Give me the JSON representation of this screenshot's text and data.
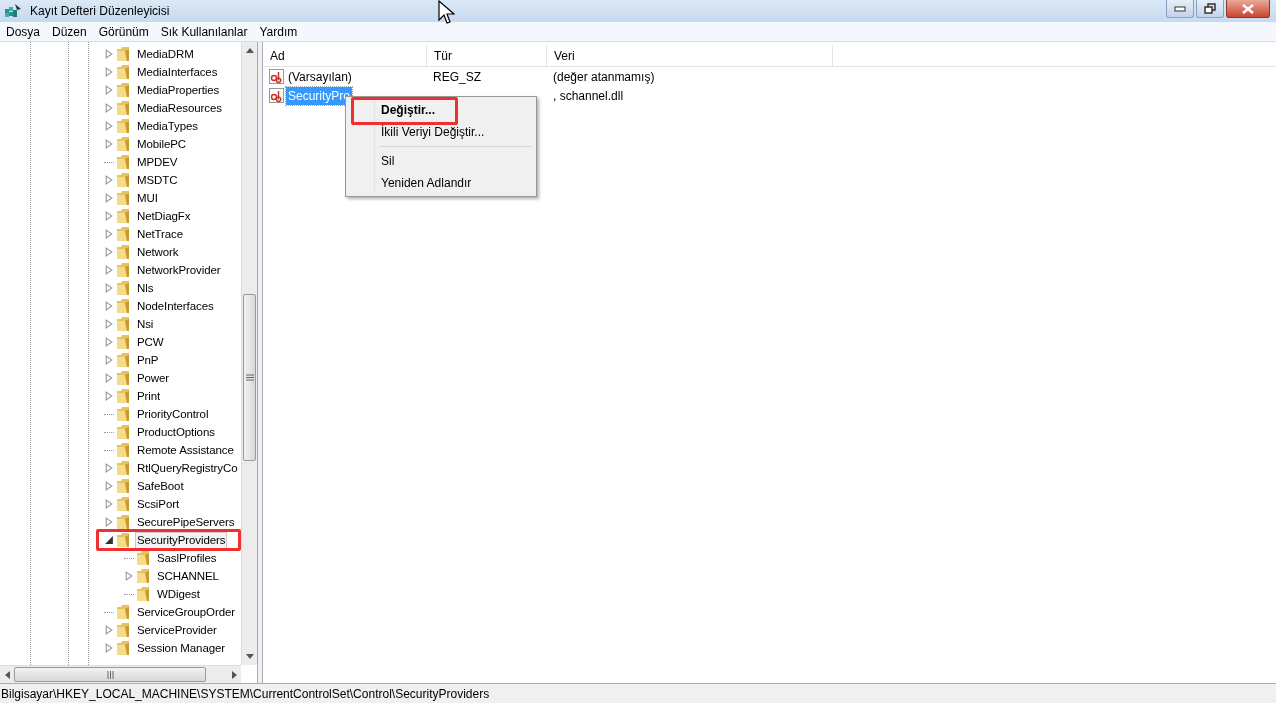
{
  "window": {
    "title": "Kayıt Defteri Düzenleyicisi"
  },
  "menu_bar": [
    "Dosya",
    "Düzen",
    "Görünüm",
    "Sık Kullanılanlar",
    "Yardım"
  ],
  "tree": {
    "items": [
      {
        "label": "MediaDRM",
        "expandable": true,
        "expanded": false,
        "selected": false,
        "annotated": false
      },
      {
        "label": "MediaInterfaces",
        "expandable": true,
        "expanded": false,
        "selected": false,
        "annotated": false
      },
      {
        "label": "MediaProperties",
        "expandable": true,
        "expanded": false,
        "selected": false,
        "annotated": false
      },
      {
        "label": "MediaResources",
        "expandable": true,
        "expanded": false,
        "selected": false,
        "annotated": false
      },
      {
        "label": "MediaTypes",
        "expandable": true,
        "expanded": false,
        "selected": false,
        "annotated": false
      },
      {
        "label": "MobilePC",
        "expandable": true,
        "expanded": false,
        "selected": false,
        "annotated": false
      },
      {
        "label": "MPDEV",
        "expandable": false,
        "expanded": false,
        "selected": false,
        "annotated": false
      },
      {
        "label": "MSDTC",
        "expandable": true,
        "expanded": false,
        "selected": false,
        "annotated": false
      },
      {
        "label": "MUI",
        "expandable": true,
        "expanded": false,
        "selected": false,
        "annotated": false
      },
      {
        "label": "NetDiagFx",
        "expandable": true,
        "expanded": false,
        "selected": false,
        "annotated": false
      },
      {
        "label": "NetTrace",
        "expandable": true,
        "expanded": false,
        "selected": false,
        "annotated": false
      },
      {
        "label": "Network",
        "expandable": true,
        "expanded": false,
        "selected": false,
        "annotated": false
      },
      {
        "label": "NetworkProvider",
        "expandable": true,
        "expanded": false,
        "selected": false,
        "annotated": false
      },
      {
        "label": "Nls",
        "expandable": true,
        "expanded": false,
        "selected": false,
        "annotated": false
      },
      {
        "label": "NodeInterfaces",
        "expandable": true,
        "expanded": false,
        "selected": false,
        "annotated": false
      },
      {
        "label": "Nsi",
        "expandable": true,
        "expanded": false,
        "selected": false,
        "annotated": false
      },
      {
        "label": "PCW",
        "expandable": true,
        "expanded": false,
        "selected": false,
        "annotated": false
      },
      {
        "label": "PnP",
        "expandable": true,
        "expanded": false,
        "selected": false,
        "annotated": false
      },
      {
        "label": "Power",
        "expandable": true,
        "expanded": false,
        "selected": false,
        "annotated": false
      },
      {
        "label": "Print",
        "expandable": true,
        "expanded": false,
        "selected": false,
        "annotated": false
      },
      {
        "label": "PriorityControl",
        "expandable": false,
        "expanded": false,
        "selected": false,
        "annotated": false
      },
      {
        "label": "ProductOptions",
        "expandable": false,
        "expanded": false,
        "selected": false,
        "annotated": false
      },
      {
        "label": "Remote Assistance",
        "expandable": false,
        "expanded": false,
        "selected": false,
        "annotated": false
      },
      {
        "label": "RtlQueryRegistryCo",
        "expandable": true,
        "expanded": false,
        "selected": false,
        "annotated": false
      },
      {
        "label": "SafeBoot",
        "expandable": true,
        "expanded": false,
        "selected": false,
        "annotated": false
      },
      {
        "label": "ScsiPort",
        "expandable": true,
        "expanded": false,
        "selected": false,
        "annotated": false
      },
      {
        "label": "SecurePipeServers",
        "expandable": true,
        "expanded": false,
        "selected": false,
        "annotated": false
      },
      {
        "label": "SecurityProviders",
        "expandable": true,
        "expanded": true,
        "selected": true,
        "annotated": true,
        "children": [
          {
            "label": "SaslProfiles",
            "expandable": false,
            "expanded": false,
            "selected": false,
            "annotated": false
          },
          {
            "label": "SCHANNEL",
            "expandable": true,
            "expanded": false,
            "selected": false,
            "annotated": false
          },
          {
            "label": "WDigest",
            "expandable": false,
            "expanded": false,
            "selected": false,
            "annotated": false
          }
        ]
      },
      {
        "label": "ServiceGroupOrder",
        "expandable": false,
        "expanded": false,
        "selected": false,
        "annotated": false
      },
      {
        "label": "ServiceProvider",
        "expandable": true,
        "expanded": false,
        "selected": false,
        "annotated": false
      },
      {
        "label": "Session Manager",
        "expandable": true,
        "expanded": false,
        "selected": false,
        "annotated": false
      }
    ]
  },
  "values_table": {
    "columns": [
      "Ad",
      "Tür",
      "Veri"
    ],
    "rows": [
      {
        "name": "(Varsayılan)",
        "type": "REG_SZ",
        "data": "(değer atanmamış)",
        "selected": false
      },
      {
        "name": "SecurityPro",
        "data": ", schannel.dll",
        "selected": true
      }
    ]
  },
  "context_menu": {
    "items": [
      {
        "kind": "item",
        "label": "Değiştir...",
        "default": true,
        "annotated": true
      },
      {
        "kind": "item",
        "label": "İkili Veriyi Değiştir...",
        "default": false,
        "annotated": false
      },
      {
        "kind": "separator"
      },
      {
        "kind": "item",
        "label": "Sil",
        "default": false,
        "annotated": false
      },
      {
        "kind": "item",
        "label": "Yeniden Adlandır",
        "default": false,
        "annotated": false
      }
    ]
  },
  "status_bar": "Bilgisayar\\HKEY_LOCAL_MACHINE\\SYSTEM\\CurrentControlSet\\Control\\SecurityProviders"
}
